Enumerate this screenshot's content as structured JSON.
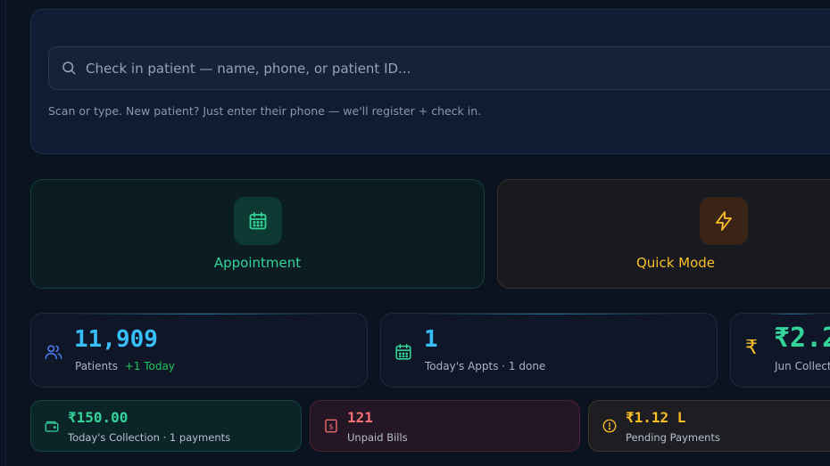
{
  "checkin": {
    "placeholder": "Check in patient — name, phone, or patient ID...",
    "hint": "Scan or type. New patient? Just enter their phone — we'll register + check in."
  },
  "modes": [
    {
      "label": "Appointment",
      "icon": "calendar-icon",
      "color": "#34d399"
    },
    {
      "label": "Quick Mode",
      "icon": "lightning-icon",
      "color": "#fbbf24"
    }
  ],
  "stats": [
    {
      "value": "11,909",
      "label": "Patients",
      "delta": "+1 Today",
      "icon": "users-icon",
      "color": "#38bdf8"
    },
    {
      "value": "1",
      "label": "Today's Appts · 1 done",
      "icon": "calendar-icon",
      "color": "#38bdf8"
    },
    {
      "value": "₹2.2",
      "label": "Jun Collect",
      "icon": "rupee-icon",
      "color": "#34d399"
    }
  ],
  "mini": [
    {
      "value": "₹150.00",
      "label": "Today's Collection · 1 payments",
      "icon": "wallet-icon",
      "color": "#34d399"
    },
    {
      "value": "121",
      "label": "Unpaid Bills",
      "icon": "bill-icon",
      "color": "#f87171"
    },
    {
      "value": "₹1.12 L",
      "label": "Pending Payments",
      "icon": "alert-circle-icon",
      "color": "#fbbf24"
    }
  ]
}
